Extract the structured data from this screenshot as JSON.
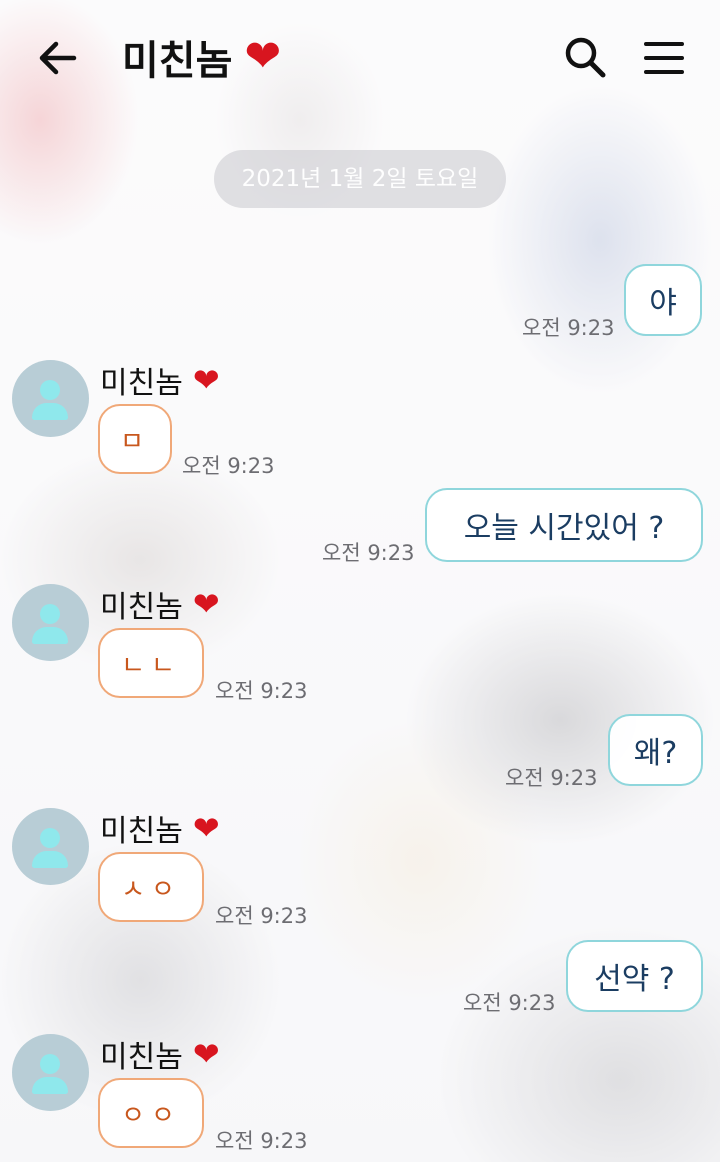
{
  "header": {
    "title": "미친놈",
    "title_emoji": "❤",
    "back_icon": "arrow-left-icon",
    "search_icon": "search-icon",
    "menu_icon": "hamburger-menu-icon"
  },
  "date_divider": "2021년 1월 2일 토요일",
  "contact": {
    "name": "미친놈",
    "emoji": "❤"
  },
  "colors": {
    "sent_border": "#8fd6dc",
    "sent_text": "#1b3d62",
    "received_border": "#f0a878",
    "received_text": "#c8571d",
    "avatar_bg": "#b8cdd6",
    "heart": "#d8151f"
  },
  "messages": [
    {
      "direction": "sent",
      "text": "야",
      "time": "오전 9:23"
    },
    {
      "direction": "received",
      "text": "ㅁ",
      "time": "오전 9:23"
    },
    {
      "direction": "sent",
      "text": "오늘 시간있어 ?",
      "time": "오전 9:23"
    },
    {
      "direction": "received",
      "text": "ㄴㄴ",
      "time": "오전 9:23"
    },
    {
      "direction": "sent",
      "text": "왜?",
      "time": "오전 9:23"
    },
    {
      "direction": "received",
      "text": "ㅅㅇ",
      "time": "오전 9:23"
    },
    {
      "direction": "sent",
      "text": "선약 ?",
      "time": "오전 9:23"
    },
    {
      "direction": "received",
      "text": "ㅇㅇ",
      "time": "오전 9:23"
    }
  ]
}
